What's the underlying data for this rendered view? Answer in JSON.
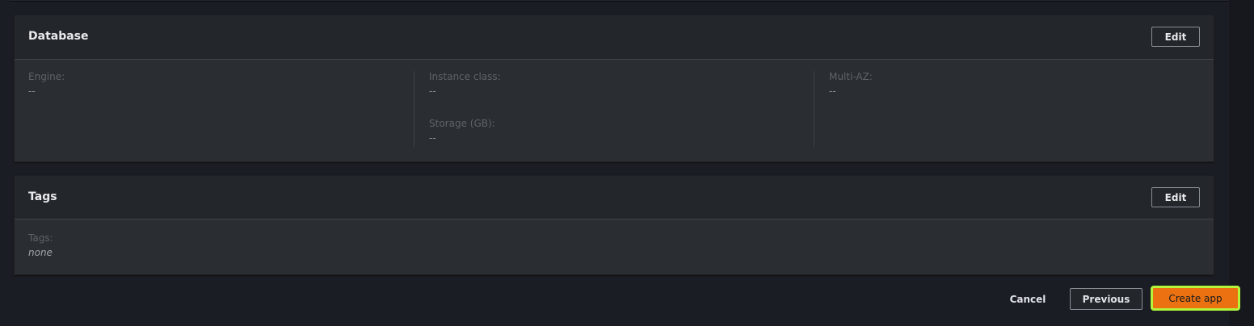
{
  "database": {
    "title": "Database",
    "edit_label": "Edit",
    "fields": {
      "engine_label": "Engine:",
      "engine_value": "--",
      "instance_label": "Instance class:",
      "instance_value": "--",
      "storage_label": "Storage (GB):",
      "storage_value": "--",
      "multiaz_label": "Multi-AZ:",
      "multiaz_value": "--"
    }
  },
  "tags": {
    "title": "Tags",
    "edit_label": "Edit",
    "label": "Tags:",
    "value": "none"
  },
  "footer": {
    "cancel_label": "Cancel",
    "previous_label": "Previous",
    "create_label": "Create app"
  },
  "colors": {
    "accent": "#ec7211",
    "focus": "#b2f53b"
  }
}
